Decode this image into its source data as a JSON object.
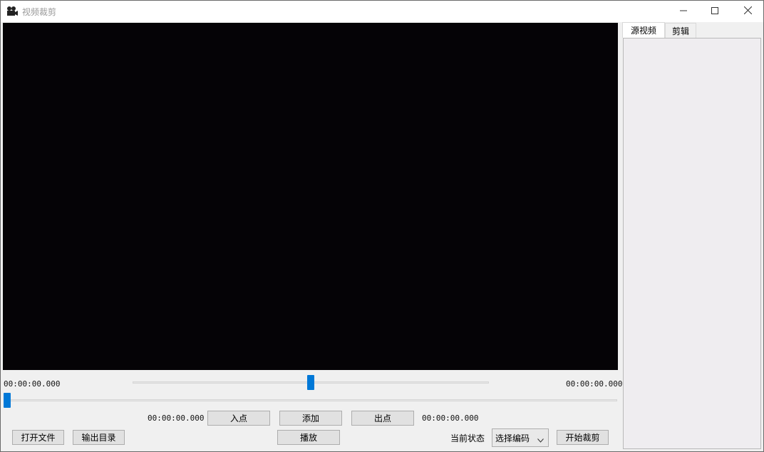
{
  "window": {
    "title": "视频裁剪",
    "icons": {
      "app": "video-camera-icon",
      "minimize": "minimize-icon",
      "maximize": "maximize-icon",
      "close": "close-icon"
    }
  },
  "timeline": {
    "current_time": "00:00:00.000",
    "total_time": "00:00:00.000",
    "volume_level": 0.5,
    "progress": 0.0
  },
  "clip": {
    "in_time": "00:00:00.000",
    "in_label": "入点",
    "add_label": "添加",
    "out_label": "出点",
    "out_time": "00:00:00.000"
  },
  "controls": {
    "open_file": "打开文件",
    "output_dir": "输出目录",
    "play": "播放",
    "status_label": "当前状态",
    "encoding_select": "选择编码",
    "start_crop": "开始裁剪"
  },
  "side_panel": {
    "tabs": [
      {
        "label": "源视频",
        "active": true
      },
      {
        "label": "剪辑",
        "active": false
      }
    ]
  }
}
